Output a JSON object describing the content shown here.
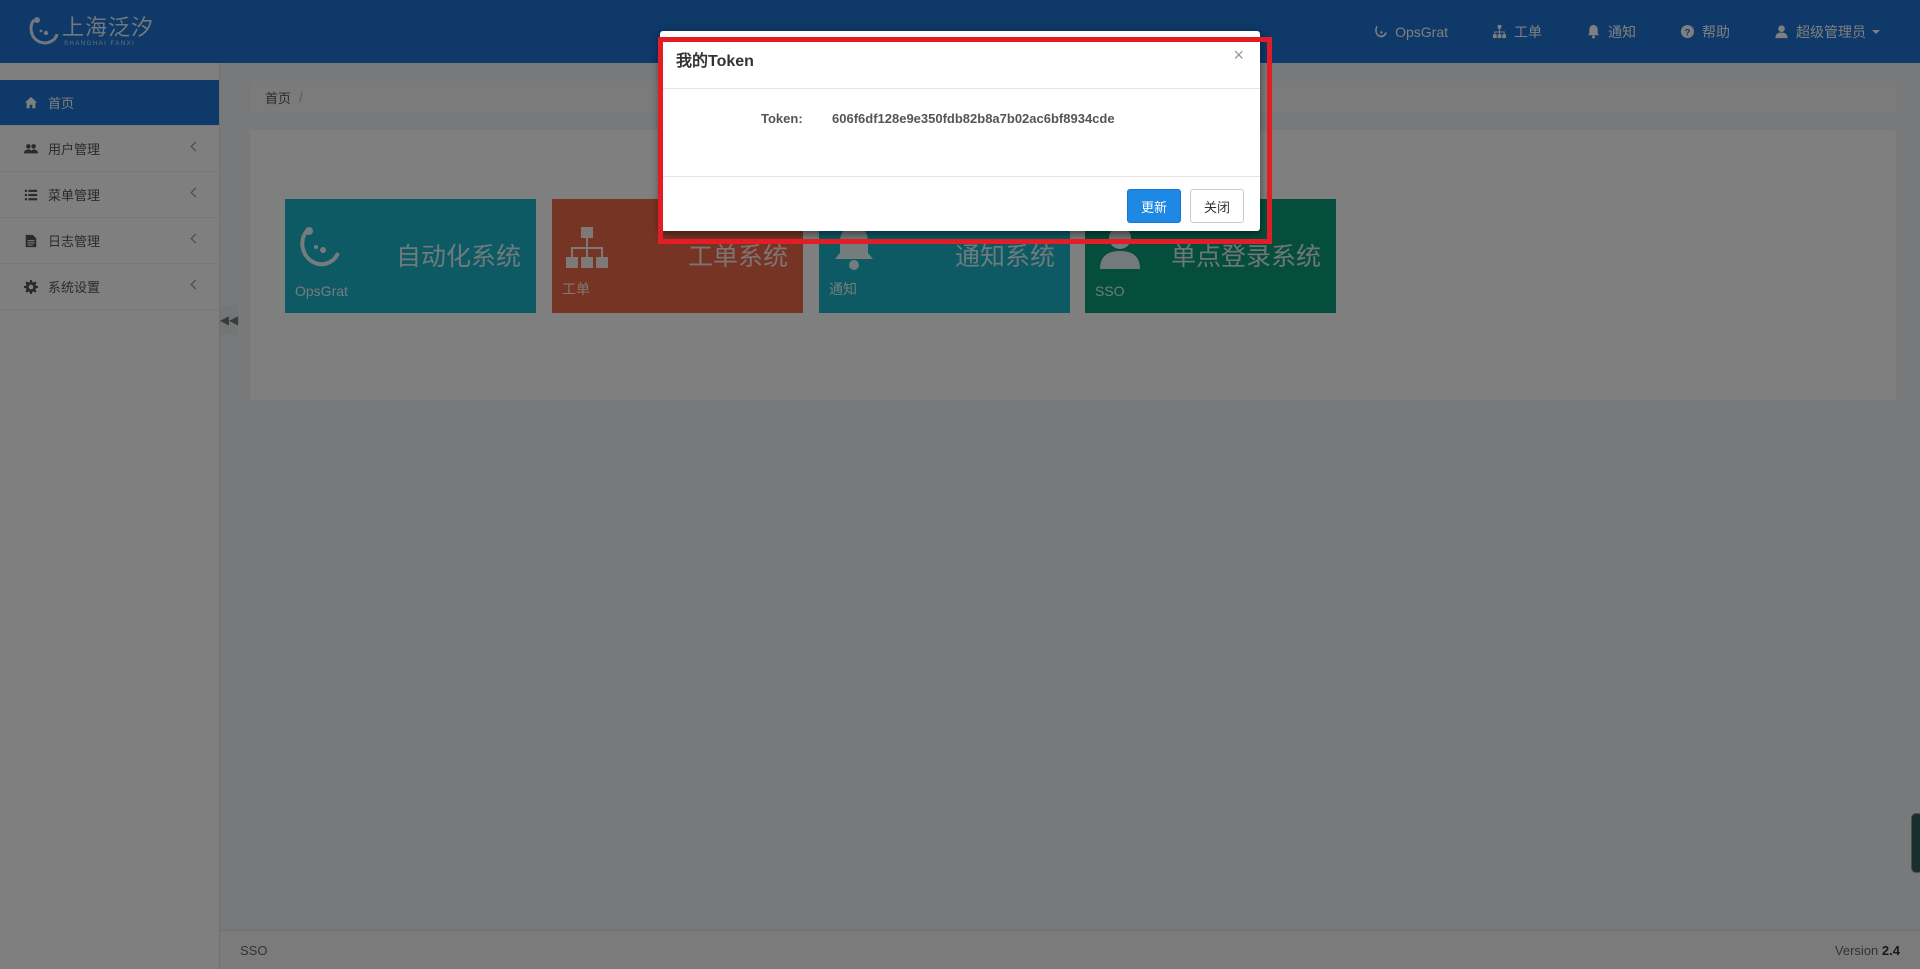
{
  "brand": {
    "name_cn": "上海泛汐",
    "name_en": "SHANGHAI FANXI"
  },
  "topnav": {
    "items": [
      {
        "label": "OpsGrat",
        "icon": "opsgrat-logo-icon"
      },
      {
        "label": "工单",
        "icon": "sitemap-icon"
      },
      {
        "label": "通知",
        "icon": "bell-icon"
      },
      {
        "label": "帮助",
        "icon": "question-circle-icon"
      },
      {
        "label": "超级管理员",
        "icon": "user-icon"
      }
    ]
  },
  "sidebar": {
    "items": [
      {
        "label": "首页",
        "icon": "home-icon",
        "active": true
      },
      {
        "label": "用户管理",
        "icon": "users-icon"
      },
      {
        "label": "菜单管理",
        "icon": "list-icon"
      },
      {
        "label": "日志管理",
        "icon": "file-icon"
      },
      {
        "label": "系统设置",
        "icon": "gear-icon"
      }
    ]
  },
  "breadcrumb": {
    "home": "首页",
    "separator": "/"
  },
  "tiles": [
    {
      "title": "自动化系统",
      "sub": "OpsGrat",
      "color": "#1ab5cb"
    },
    {
      "title": "工单系统",
      "sub": "工单",
      "color": "#ec6a49"
    },
    {
      "title": "通知系统",
      "sub": "通知",
      "color": "#1ab5cb"
    },
    {
      "title": "单点登录系统",
      "sub": "SSO",
      "color": "#0b9a7a"
    }
  ],
  "footer": {
    "left": "SSO",
    "version_label": "Version",
    "version": "2.4"
  },
  "modal": {
    "title": "我的Token",
    "close": "×",
    "token_label": "Token:",
    "token_value": "606f6df128e9e350fdb82b8a7b02ac6bf8934cde",
    "update_button": "更新",
    "close_button": "关闭"
  },
  "colors": {
    "primary": "#1d72d1",
    "highlight": "#e31d26"
  }
}
